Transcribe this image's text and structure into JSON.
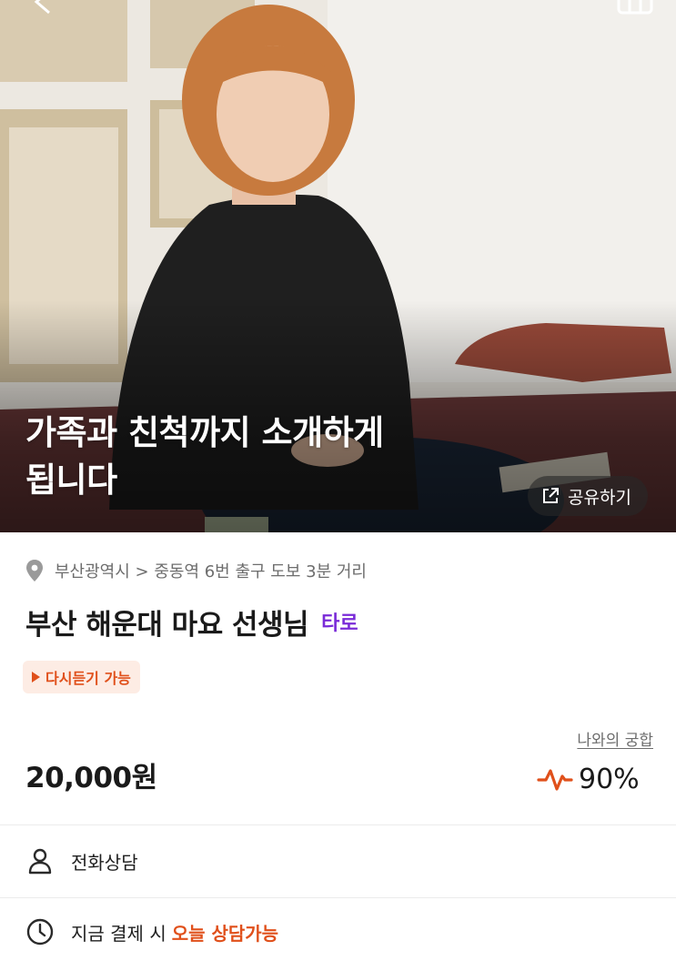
{
  "hero": {
    "title_line1": "가족과 친척까지 소개하게",
    "title_line2": "됩니다",
    "share_label": "공유하기"
  },
  "info": {
    "location": "부산광역시 > 중동역 6번 출구 도보 3분 거리",
    "name": "부산 해운대 마요 선생님",
    "category": "타로",
    "replay_badge": "다시듣기 가능",
    "price": "20,000원",
    "compat_label": "나와의 궁합",
    "compat_value": "90%"
  },
  "details": {
    "consult_type": "전화상담",
    "pay_prefix": "지금 결제 시",
    "pay_highlight": "오늘 상담가능"
  },
  "icons": {
    "back": "chevron-left-icon",
    "menu": "menu-icon",
    "share": "external-link-icon",
    "location": "map-pin-icon",
    "replay": "play-icon",
    "compat": "pulse-icon",
    "consult": "person-icon",
    "time": "clock-icon"
  },
  "colors": {
    "accent": "#e0501b",
    "category": "#7a2bd8",
    "badge_bg": "#fdece4"
  }
}
